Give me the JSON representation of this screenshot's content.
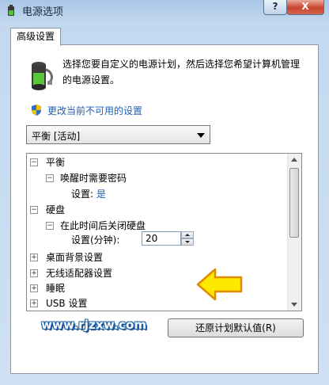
{
  "window": {
    "title": "电源选项",
    "help_label": "?",
    "close_label": "X"
  },
  "tab": {
    "label": "高级设置"
  },
  "intro": {
    "text": "选择您要自定义的电源计划，然后选择您希望计算机管理的电源设置。",
    "link": "更改当前不可用的设置"
  },
  "plan_select": {
    "value": "平衡 [活动]"
  },
  "tree": {
    "items": [
      {
        "label": "平衡",
        "expander": "−"
      },
      {
        "label": "唤醒时需要密码",
        "expander": "−"
      },
      {
        "label": "设置:",
        "value": "是"
      },
      {
        "label": "硬盘",
        "expander": "−"
      },
      {
        "label": "在此时间后关闭硬盘",
        "expander": "−"
      },
      {
        "label": "设置(分钟):",
        "value": "20"
      },
      {
        "label": "桌面背景设置",
        "expander": "+"
      },
      {
        "label": "无线适配器设置",
        "expander": "+"
      },
      {
        "label": "睡眠",
        "expander": "+"
      },
      {
        "label": "USB 设置",
        "expander": "+"
      }
    ]
  },
  "watermark": "www.rjzxw.com",
  "buttons": {
    "restore": "还原计划默认值(R)"
  },
  "colors": {
    "link": "#1f5fb0",
    "arrow_fill": "#ffe800",
    "arrow_stroke": "#e08a00"
  }
}
